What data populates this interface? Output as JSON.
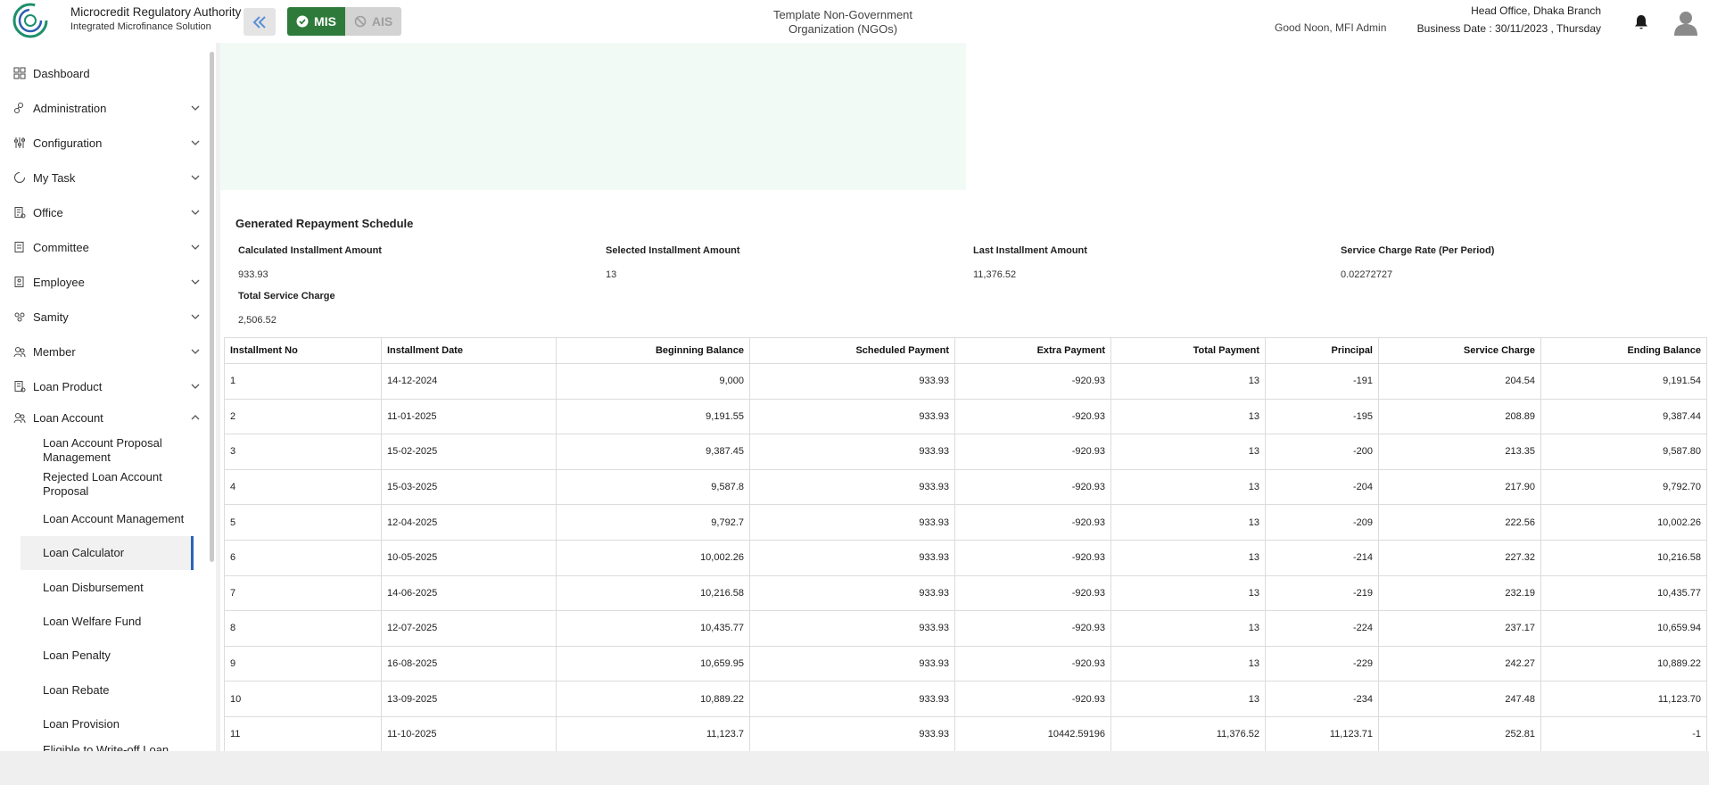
{
  "header": {
    "brand_title": "Microcredit Regulatory Authority",
    "brand_subtitle": "Integrated Microfinance Solution",
    "logo_text": "Microcredit Regulatory Authority",
    "mode_mis": "MIS",
    "mode_ais": "AIS",
    "org_name": "Template Non-Government Organization (NGOs)",
    "greeting": "Good Noon, MFI Admin",
    "branch": "Head Office, Dhaka Branch",
    "business_date": "Business Date : 30/11/2023 , Thursday",
    "colors": {
      "mis_active": "#2e7a3a",
      "ais_inactive": "#d3d3d3",
      "active_indicator": "#2b64b6",
      "mint_panel": "#f2faf6"
    }
  },
  "sidebar": {
    "items": [
      {
        "label": "Dashboard",
        "icon": "dashboard-icon"
      },
      {
        "label": "Administration",
        "icon": "administration-icon"
      },
      {
        "label": "Configuration",
        "icon": "configuration-icon"
      },
      {
        "label": "My Task",
        "icon": "task-icon"
      },
      {
        "label": "Office",
        "icon": "office-icon"
      },
      {
        "label": "Committee",
        "icon": "committee-icon"
      },
      {
        "label": "Employee",
        "icon": "employee-icon"
      },
      {
        "label": "Samity",
        "icon": "samity-icon"
      },
      {
        "label": "Member",
        "icon": "member-icon"
      },
      {
        "label": "Loan Product",
        "icon": "loan-product-icon"
      },
      {
        "label": "Loan Account",
        "icon": "loan-account-icon"
      }
    ],
    "sub_items": [
      {
        "label": "Loan Account Proposal Management"
      },
      {
        "label": "Rejected Loan Account Proposal"
      },
      {
        "label": "Loan Account Management"
      },
      {
        "label": "Loan Calculator",
        "active": true
      },
      {
        "label": "Loan Disbursement"
      },
      {
        "label": "Loan Welfare Fund"
      },
      {
        "label": "Loan Penalty"
      },
      {
        "label": "Loan Rebate"
      },
      {
        "label": "Loan Provision"
      },
      {
        "label": "Eligible to Write-off Loan"
      }
    ]
  },
  "main": {
    "section_title": "Generated Repayment Schedule",
    "summary": [
      {
        "label": "Calculated Installment Amount",
        "value": "933.93"
      },
      {
        "label": "Selected Installment Amount",
        "value": "13"
      },
      {
        "label": "Last Installment Amount",
        "value": "11,376.52"
      },
      {
        "label": "Service Charge Rate (Per Period)",
        "value": "0.02272727"
      },
      {
        "label": "Total Service Charge",
        "value": "2,506.52"
      }
    ],
    "table": {
      "columns": [
        "Installment No",
        "Installment Date",
        "Beginning Balance",
        "Scheduled Payment",
        "Extra Payment",
        "Total Payment",
        "Principal",
        "Service Charge",
        "Ending Balance"
      ],
      "rows": [
        [
          "1",
          "14-12-2024",
          "9,000",
          "933.93",
          "-920.93",
          "13",
          "-191",
          "204.54",
          "9,191.54"
        ],
        [
          "2",
          "11-01-2025",
          "9,191.55",
          "933.93",
          "-920.93",
          "13",
          "-195",
          "208.89",
          "9,387.44"
        ],
        [
          "3",
          "15-02-2025",
          "9,387.45",
          "933.93",
          "-920.93",
          "13",
          "-200",
          "213.35",
          "9,587.80"
        ],
        [
          "4",
          "15-03-2025",
          "9,587.8",
          "933.93",
          "-920.93",
          "13",
          "-204",
          "217.90",
          "9,792.70"
        ],
        [
          "5",
          "12-04-2025",
          "9,792.7",
          "933.93",
          "-920.93",
          "13",
          "-209",
          "222.56",
          "10,002.26"
        ],
        [
          "6",
          "10-05-2025",
          "10,002.26",
          "933.93",
          "-920.93",
          "13",
          "-214",
          "227.32",
          "10,216.58"
        ],
        [
          "7",
          "14-06-2025",
          "10,216.58",
          "933.93",
          "-920.93",
          "13",
          "-219",
          "232.19",
          "10,435.77"
        ],
        [
          "8",
          "12-07-2025",
          "10,435.77",
          "933.93",
          "-920.93",
          "13",
          "-224",
          "237.17",
          "10,659.94"
        ],
        [
          "9",
          "16-08-2025",
          "10,659.95",
          "933.93",
          "-920.93",
          "13",
          "-229",
          "242.27",
          "10,889.22"
        ],
        [
          "10",
          "13-09-2025",
          "10,889.22",
          "933.93",
          "-920.93",
          "13",
          "-234",
          "247.48",
          "11,123.70"
        ],
        [
          "11",
          "11-10-2025",
          "11,123.7",
          "933.93",
          "10442.59196",
          "11,376.52",
          "11,123.71",
          "252.81",
          "-1"
        ]
      ]
    }
  }
}
